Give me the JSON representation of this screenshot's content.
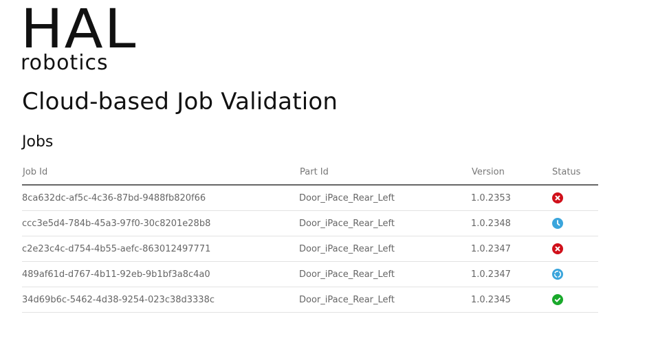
{
  "logo": {
    "line1": "HAL",
    "line2": "robotics"
  },
  "title": "Cloud-based Job Validation",
  "section": "Jobs",
  "columns": [
    "Job Id",
    "Part Id",
    "Version",
    "Status"
  ],
  "colors": {
    "failed": "#d0101a",
    "pending": "#3aa5dc",
    "running": "#3aa5dc",
    "success": "#19a92b"
  },
  "jobs": [
    {
      "id": "8ca632dc-af5c-4c36-87bd-9488fb820f66",
      "part": "Door_iPace_Rear_Left",
      "version": "1.0.2353",
      "status": "failed"
    },
    {
      "id": "ccc3e5d4-784b-45a3-97f0-30c8201e28b8",
      "part": "Door_iPace_Rear_Left",
      "version": "1.0.2348",
      "status": "pending"
    },
    {
      "id": "c2e23c4c-d754-4b55-aefc-863012497771",
      "part": "Door_iPace_Rear_Left",
      "version": "1.0.2347",
      "status": "failed"
    },
    {
      "id": "489af61d-d767-4b11-92eb-9b1bf3a8c4a0",
      "part": "Door_iPace_Rear_Left",
      "version": "1.0.2347",
      "status": "running"
    },
    {
      "id": "34d69b6c-5462-4d38-9254-023c38d3338c",
      "part": "Door_iPace_Rear_Left",
      "version": "1.0.2345",
      "status": "success"
    }
  ]
}
